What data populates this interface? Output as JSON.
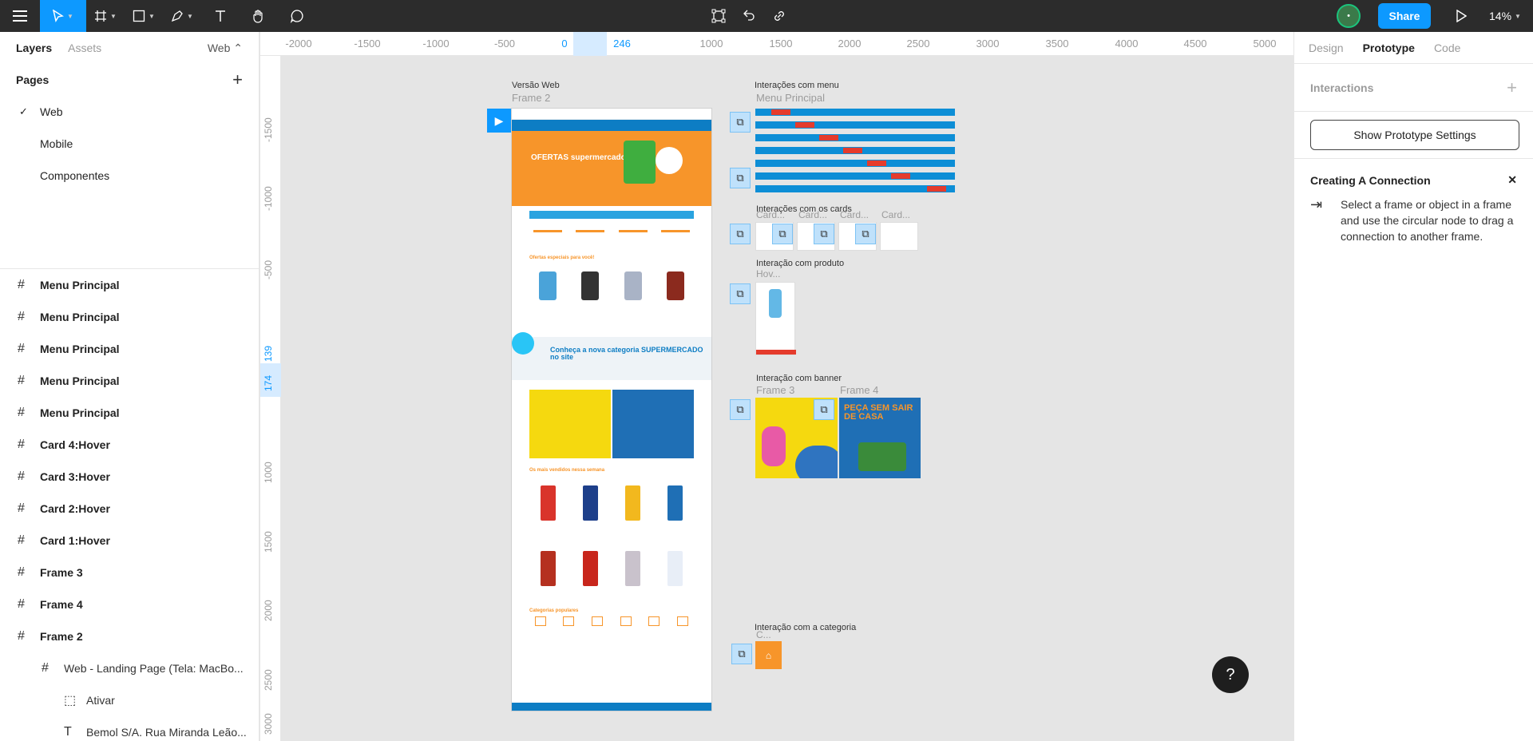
{
  "toolbar": {
    "zoom": "14%",
    "share_label": "Share",
    "avatar_initial": "•"
  },
  "left_panel": {
    "tabs": [
      "Layers",
      "Assets"
    ],
    "page_selector": "Web ⌃",
    "pages_title": "Pages",
    "pages": [
      {
        "label": "Web",
        "active": true
      },
      {
        "label": "Mobile",
        "active": false
      },
      {
        "label": "Componentes",
        "active": false
      }
    ],
    "layers": [
      {
        "label": "Menu Principal",
        "kind": "frame"
      },
      {
        "label": "Menu Principal",
        "kind": "frame"
      },
      {
        "label": "Menu Principal",
        "kind": "frame"
      },
      {
        "label": "Menu Principal",
        "kind": "frame"
      },
      {
        "label": "Menu Principal",
        "kind": "frame"
      },
      {
        "label": "Card 4:Hover",
        "kind": "frame"
      },
      {
        "label": "Card 3:Hover",
        "kind": "frame"
      },
      {
        "label": "Card 2:Hover",
        "kind": "frame"
      },
      {
        "label": "Card 1:Hover",
        "kind": "frame"
      },
      {
        "label": "Frame 3",
        "kind": "frame"
      },
      {
        "label": "Frame 4",
        "kind": "frame"
      },
      {
        "label": "Frame 2",
        "kind": "frame"
      },
      {
        "label": "Web - Landing Page (Tela: MacBo...",
        "kind": "frame-sub"
      },
      {
        "label": "Ativar",
        "kind": "dashed-sub"
      },
      {
        "label": "Bemol S/A. Rua Miranda Leão...",
        "kind": "text-sub"
      }
    ]
  },
  "canvas": {
    "ruler_top": [
      "-2000",
      "-1500",
      "-1000",
      "-500",
      "0",
      "246",
      "1000",
      "1500",
      "2000",
      "2500",
      "3000",
      "3500",
      "4000",
      "4500",
      "5000"
    ],
    "ruler_left": [
      "-1500",
      "-1000",
      "-500",
      "139",
      "174",
      "1000",
      "1500",
      "2000",
      "2500",
      "3000"
    ],
    "labels": {
      "versao_web": "Versão Web",
      "frame2": "Frame 2",
      "interacoes_menu": "Interações com menu",
      "menu_principal": "Menu Principal",
      "interacoes_cards": "Interações com os cards",
      "card_names": [
        "Card...",
        "Card...",
        "Card...",
        "Card..."
      ],
      "interacao_produto": "Interação com produto",
      "hover": "Hov...",
      "interacao_banner": "Interação com banner",
      "frame3": "Frame 3",
      "frame4": "Frame 4",
      "interacao_categoria": "Interação com a categoria",
      "categoria_short": "C..."
    },
    "frame2_content": {
      "hero_text": "OFERTAS supermercado",
      "section_offers": "Ofertas especiais para você!",
      "category_text": "Conheça a nova categoria SUPERMERCADO no site",
      "banner_text": "PEÇA SEM SAIR DE CASA",
      "section_best": "Os mais vendidos nessa semana",
      "section_cats": "Categorias populares"
    }
  },
  "right_panel": {
    "tabs": [
      "Design",
      "Prototype",
      "Code"
    ],
    "active_tab": "Prototype",
    "interactions_title": "Interactions",
    "proto_settings_button": "Show Prototype Settings",
    "connection_title": "Creating A Connection",
    "connection_text": "Select a frame or object in a frame and use the circular node to drag a connection to another frame."
  },
  "help_label": "?"
}
